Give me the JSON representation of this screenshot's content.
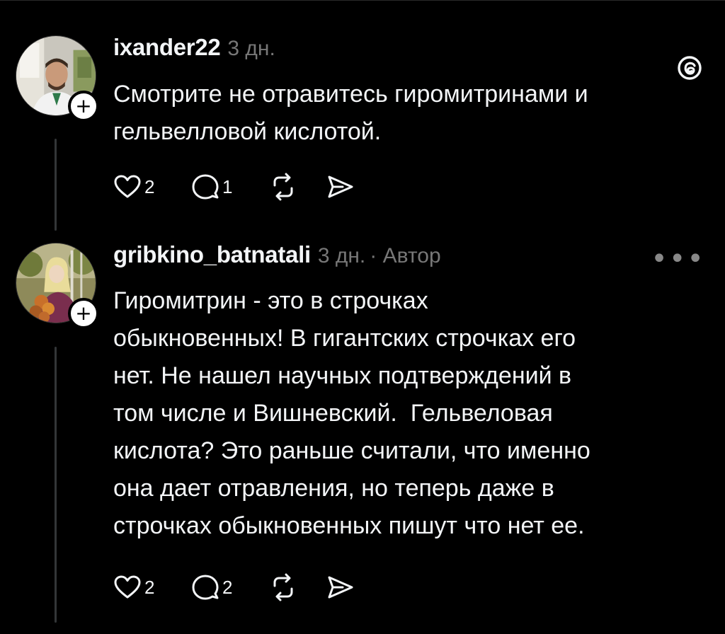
{
  "posts": [
    {
      "username": "ixander22",
      "time": "3 дн.",
      "author_label": "",
      "text": "Смотрите не отравитесь гиромитринами и\nгельвелловой кислотой.",
      "likes": "2",
      "replies": "1",
      "corner_icon": "threads-logo-icon"
    },
    {
      "username": "gribkino_batnatali",
      "time": "3 дн.",
      "author_label": "· Автор",
      "text": "Гиромитрин - это в строчках\nобыкновенных! В гигантских строчках его\nнет. Не нашел научных подтверждений в\nтом числе и Вишневский.  Гельвеловая\nкислота? Это раньше считали, что именно\nона дает отравления, но теперь даже в\nстрочках обыкновенных пишут что нет ее.",
      "likes": "2",
      "replies": "2",
      "corner_icon": "more-options-icon"
    }
  ],
  "colors": {
    "background": "#000000",
    "text": "#f3f5f7",
    "muted": "#777777",
    "thread_line": "#333638"
  }
}
